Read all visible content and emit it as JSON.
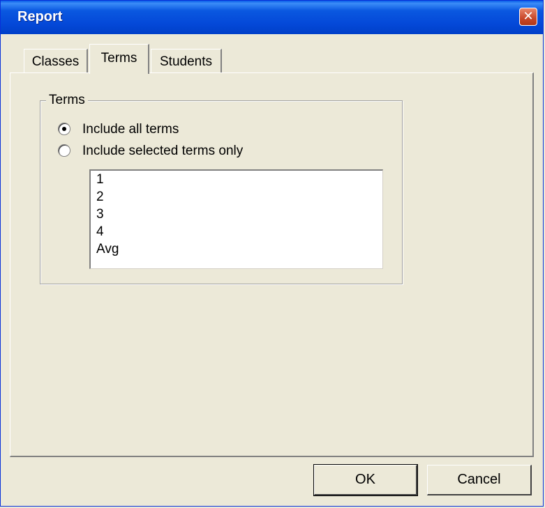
{
  "window": {
    "title": "Report"
  },
  "tabs": [
    {
      "label": "Classes",
      "active": false
    },
    {
      "label": "Terms",
      "active": true
    },
    {
      "label": "Students",
      "active": false
    }
  ],
  "terms_group": {
    "legend": "Terms",
    "options": [
      {
        "label": "Include all terms",
        "selected": true
      },
      {
        "label": "Include selected terms only",
        "selected": false
      }
    ],
    "list_items": [
      "1",
      "2",
      "3",
      "4",
      "Avg"
    ]
  },
  "buttons": {
    "ok": "OK",
    "cancel": "Cancel"
  },
  "icons": {
    "close": "close-icon"
  },
  "colors": {
    "titlebar": "#0448D8",
    "dialog_bg": "#ECE9D8",
    "close_button": "#C8482A"
  }
}
